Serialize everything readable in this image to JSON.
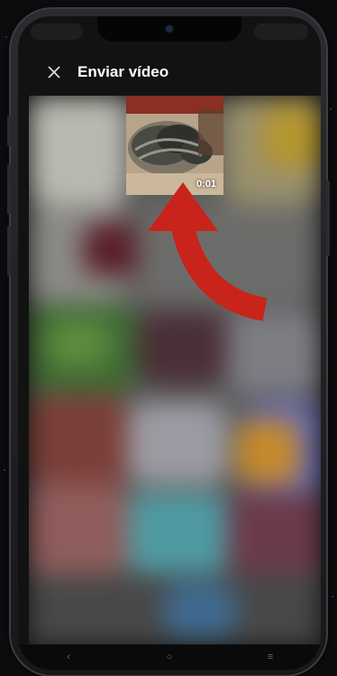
{
  "header": {
    "title": "Enviar vídeo",
    "close_icon": "close-icon"
  },
  "video_tile": {
    "duration": "0:01"
  },
  "nav_bar": {
    "back_glyph": "‹",
    "home_glyph": "○",
    "recents_glyph": "≡"
  },
  "annotation": {
    "arrow_color": "#c8241b"
  },
  "colors": {
    "header_background": "#121212",
    "title_text": "#ffffff"
  }
}
